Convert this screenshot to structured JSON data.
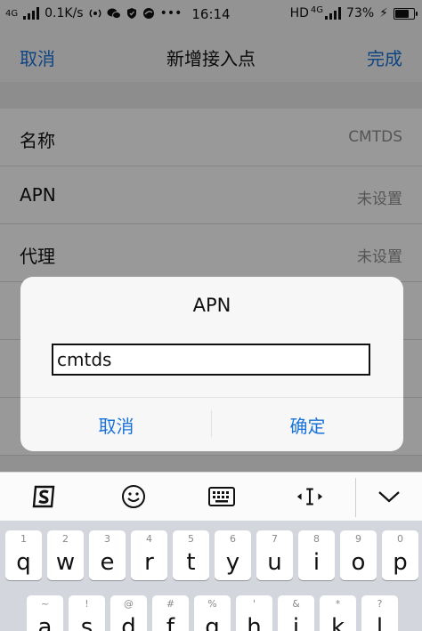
{
  "status": {
    "network": "4G",
    "speed": "0.1K/s",
    "time": "16:14",
    "hd": "HD",
    "net2": "4G",
    "battery": "73%"
  },
  "nav": {
    "cancel": "取消",
    "title": "新增接入点",
    "done": "完成"
  },
  "fields": [
    {
      "label": "名称",
      "value": "CMTDS"
    },
    {
      "label": "APN",
      "value": "未设置"
    },
    {
      "label": "代理",
      "value": "未设置"
    }
  ],
  "dialog": {
    "title": "APN",
    "input_value": "cmtds",
    "cancel": "取消",
    "ok": "确定"
  },
  "keyboard": {
    "row1": [
      {
        "d": "1",
        "c": "q"
      },
      {
        "d": "2",
        "c": "w"
      },
      {
        "d": "3",
        "c": "e"
      },
      {
        "d": "4",
        "c": "r"
      },
      {
        "d": "5",
        "c": "t"
      },
      {
        "d": "6",
        "c": "y"
      },
      {
        "d": "7",
        "c": "u"
      },
      {
        "d": "8",
        "c": "i"
      },
      {
        "d": "9",
        "c": "o"
      },
      {
        "d": "0",
        "c": "p"
      }
    ],
    "row2": [
      {
        "d": "~",
        "c": "a"
      },
      {
        "d": "!",
        "c": "s"
      },
      {
        "d": "@",
        "c": "d"
      },
      {
        "d": "#",
        "c": "f"
      },
      {
        "d": "%",
        "c": "g"
      },
      {
        "d": "'",
        "c": "h"
      },
      {
        "d": "&",
        "c": "j"
      },
      {
        "d": "*",
        "c": "k"
      },
      {
        "d": "?",
        "c": "l"
      }
    ]
  }
}
